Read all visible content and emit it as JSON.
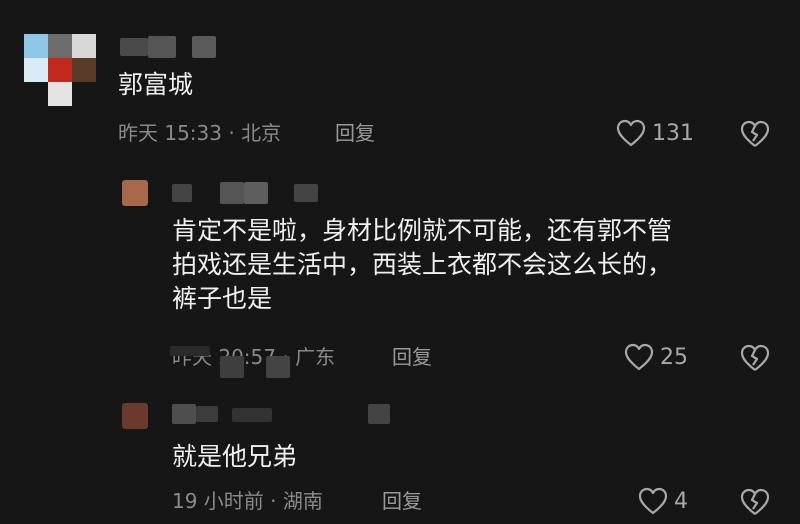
{
  "comments": [
    {
      "text": "郭富城",
      "meta": "昨天 15:33 · 北京",
      "reply": "回复",
      "likes": "131"
    },
    {
      "text_lines": [
        "肯定不是啦，身材比例就不可能，还有郭不管",
        "拍戏还是生活中，西装上衣都不会这么长的，",
        "裤子也是"
      ],
      "meta": "昨天 20:57 · 广东",
      "reply": "回复",
      "likes": "25"
    },
    {
      "text": "就是他兄弟",
      "meta": "19 小时前 · 湖南",
      "reply": "回复",
      "likes": "4"
    }
  ],
  "icons": {
    "like": "heart-outline-icon",
    "dislike": "broken-heart-icon"
  },
  "colors": {
    "background": "#161616",
    "text": "#f0f0f0",
    "meta": "#8a8a8a"
  }
}
